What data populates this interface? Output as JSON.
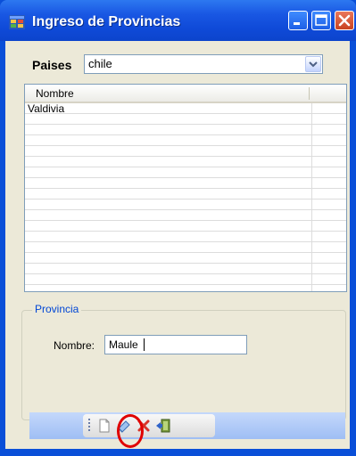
{
  "window": {
    "title": "Ingreso de Provincias",
    "title_color": "#ffffff",
    "titlebar_color": "#0c48d6",
    "close_button_color": "#d95a37"
  },
  "paises": {
    "label": "Paises",
    "selected_value": "chile"
  },
  "grid": {
    "columns": [
      "Nombre"
    ],
    "rows": [
      [
        "Valdivia"
      ]
    ]
  },
  "provincia_group": {
    "title": "Provincia",
    "title_color": "#0046d5",
    "nombre_label": "Nombre:",
    "nombre_value": "Maule"
  },
  "toolbar": {
    "items": [
      {
        "name": "new",
        "icon": "new-document-icon"
      },
      {
        "name": "edit",
        "icon": "eraser-icon"
      },
      {
        "name": "delete",
        "icon": "red-x-icon"
      },
      {
        "name": "exit",
        "icon": "exit-door-icon"
      }
    ]
  },
  "annotation": {
    "highlight_color": "#e00000",
    "highlighted_item": "edit"
  }
}
